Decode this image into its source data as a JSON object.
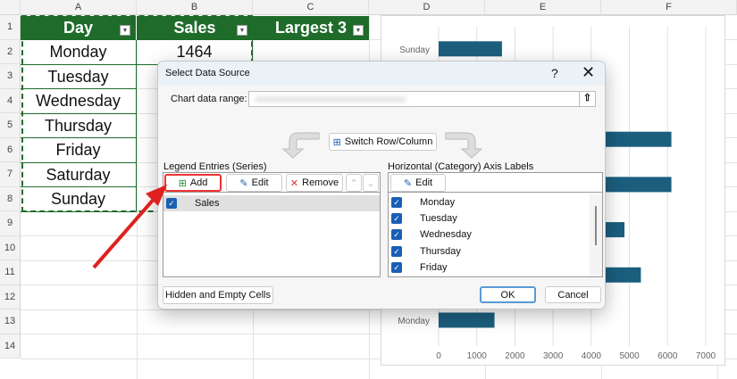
{
  "columns": [
    "A",
    "B",
    "C",
    "D",
    "E",
    "F"
  ],
  "rows": [
    "1",
    "2",
    "3",
    "4",
    "5",
    "6",
    "7",
    "8",
    "9",
    "10",
    "11",
    "12",
    "13",
    "14"
  ],
  "table": {
    "headers": [
      "Day",
      "Sales",
      "Largest 3"
    ],
    "days": [
      "Monday",
      "Tuesday",
      "Wednesday",
      "Thursday",
      "Friday",
      "Saturday",
      "Sunday"
    ],
    "sales_visible": "1464"
  },
  "chart_data": {
    "type": "bar",
    "orientation": "horizontal",
    "categories": [
      "Monday",
      "Tuesday",
      "Wednesday",
      "Thursday",
      "Friday",
      "Saturday",
      "Sunday"
    ],
    "values": [
      1464,
      5300,
      4870,
      6100,
      6100,
      null,
      1660
    ],
    "xlim": [
      0,
      7000
    ],
    "xticks": [
      "0",
      "1000",
      "2000",
      "3000",
      "4000",
      "5000",
      "6000",
      "7000"
    ],
    "visible_category_labels": {
      "Monday": "Monday",
      "Sunday": "Sunday"
    },
    "color": "#1b5e7e"
  },
  "dialog": {
    "title": "Select Data Source",
    "help": "?",
    "chart_range_label": "Chart data range:",
    "switch_label": "Switch Row/Column",
    "legend_title": "Legend Entries (Series)",
    "axis_title": "Horizontal (Category) Axis Labels",
    "add": "Add",
    "edit": "Edit",
    "remove": "Remove",
    "axis_edit": "Edit",
    "series": [
      "Sales"
    ],
    "axis_items": [
      "Monday",
      "Tuesday",
      "Wednesday",
      "Thursday",
      "Friday"
    ],
    "hidden_cells": "Hidden and Empty Cells",
    "ok": "OK",
    "cancel": "Cancel"
  }
}
